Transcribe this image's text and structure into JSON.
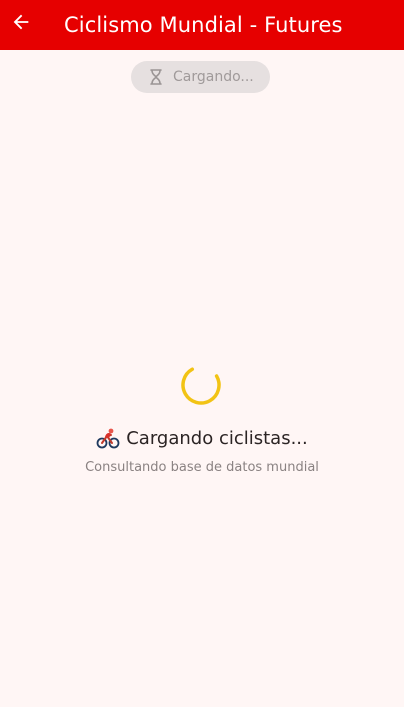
{
  "appbar": {
    "title": "Ciclismo Mundial - Futures",
    "back_icon": "arrow-back-icon",
    "background_color": "#e60000"
  },
  "status_pill": {
    "icon": "hourglass-icon",
    "label": "Cargando..."
  },
  "loading": {
    "spinner_color": "#f2c314",
    "icon": "cyclist-icon",
    "title": "Cargando ciclistas...",
    "subtitle": "Consultando base de datos mundial"
  }
}
